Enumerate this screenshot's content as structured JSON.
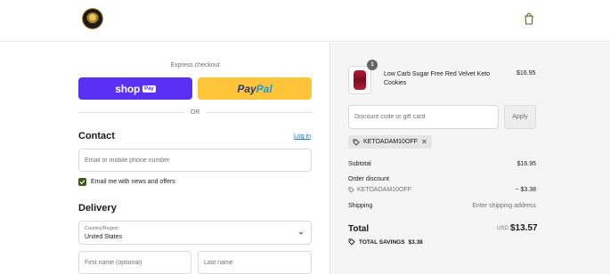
{
  "header": {
    "logo_icon": "lion-crest-logo",
    "cart_icon": "shopping-bag-icon"
  },
  "checkout": {
    "express_label": "Express checkout",
    "shop_pay": {
      "word": "shop",
      "badge": "Pay"
    },
    "paypal": {
      "part1": "Pay",
      "part2": "Pal"
    },
    "or_label": "OR",
    "contact": {
      "heading": "Contact",
      "login_link": "Log in",
      "email_placeholder": "Email or mobile phone number",
      "news_checkbox_label": "Email me with news and offers",
      "news_checked": true
    },
    "delivery": {
      "heading": "Delivery",
      "country_label": "Country/Region",
      "country_value": "United States",
      "first_name_placeholder": "First name (optional)",
      "last_name_placeholder": "Last name"
    }
  },
  "summary": {
    "item": {
      "quantity": "1",
      "name": "Low Carb Sugar Free Red Velvet Keto Cookies",
      "price": "$16.95"
    },
    "discount_placeholder": "Discount code or gift card",
    "apply_label": "Apply",
    "applied_code": "KETOADAM10OFF",
    "subtotal_label": "Subtotal",
    "subtotal_value": "$16.95",
    "order_discount_label": "Order discount",
    "discount_code": "KETOADAM10OFF",
    "discount_value": "− $3.38",
    "shipping_label": "Shipping",
    "shipping_value": "Enter shipping address",
    "total_label": "Total",
    "total_currency": "USD",
    "total_value": "$13.57",
    "savings_label": "TOTAL SAVINGS",
    "savings_value": "$3.38"
  },
  "colors": {
    "shop_pay": "#5a31f4",
    "paypal": "#ffc439",
    "link": "#1773b0",
    "checkbox": "#3f5821",
    "summary_bg": "#f5f5f5"
  }
}
